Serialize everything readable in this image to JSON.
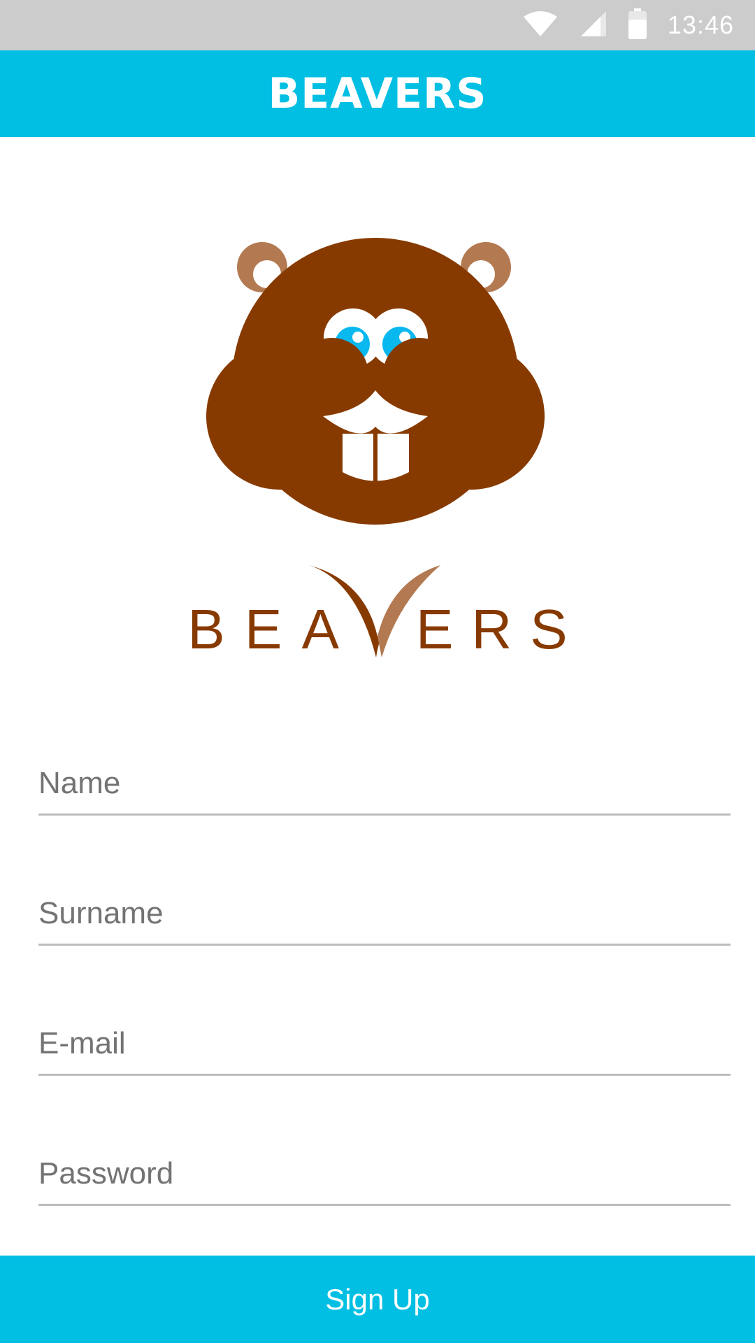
{
  "status_bar": {
    "time": "13:46",
    "icons": [
      "wifi-icon",
      "cell-signal-icon",
      "battery-icon"
    ]
  },
  "app_bar": {
    "title": "BEAVERS"
  },
  "logo": {
    "wordmark": "BEAVERS",
    "letters": [
      "B",
      "E",
      "A",
      "E",
      "R",
      "S"
    ],
    "colors": {
      "body": "#873a00",
      "ears": "#b37a52",
      "eyes": "#0ab8f0"
    }
  },
  "form": {
    "name_placeholder": "Name",
    "surname_placeholder": "Surname",
    "email_placeholder": "E-mail",
    "password_placeholder": "Password",
    "name_value": "",
    "surname_value": "",
    "email_value": "",
    "password_value": ""
  },
  "signup_button": {
    "label": "Sign Up"
  },
  "colors": {
    "accent": "#00bfe3",
    "status_bar": "#cccccc",
    "divider": "#bdbdbd",
    "placeholder": "#737373"
  }
}
